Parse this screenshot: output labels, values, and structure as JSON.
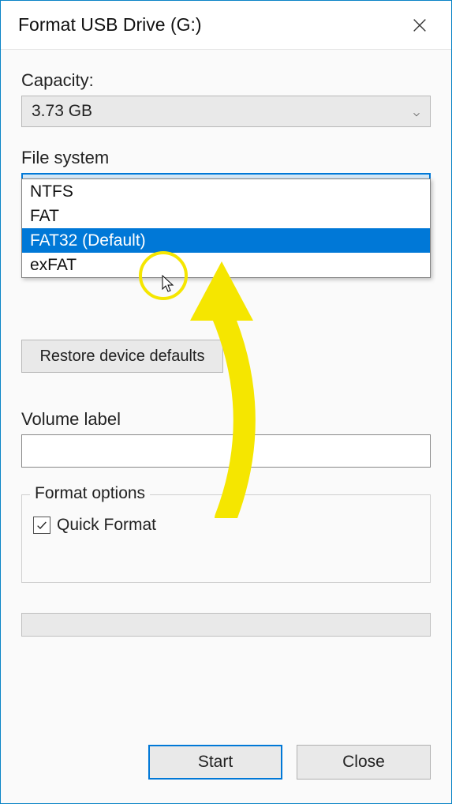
{
  "window": {
    "title": "Format USB Drive (G:)"
  },
  "capacity": {
    "label": "Capacity:",
    "value": "3.73 GB"
  },
  "filesystem": {
    "label": "File system",
    "selected": "FAT32 (Default)",
    "options": [
      "NTFS",
      "FAT",
      "FAT32 (Default)",
      "exFAT"
    ],
    "highlighted_index": 2
  },
  "restore_button": "Restore device defaults",
  "volume_label": {
    "label": "Volume label",
    "value": ""
  },
  "format_options": {
    "legend": "Format options",
    "quick_format_label": "Quick Format",
    "quick_format_checked": true
  },
  "buttons": {
    "start": "Start",
    "close": "Close"
  }
}
